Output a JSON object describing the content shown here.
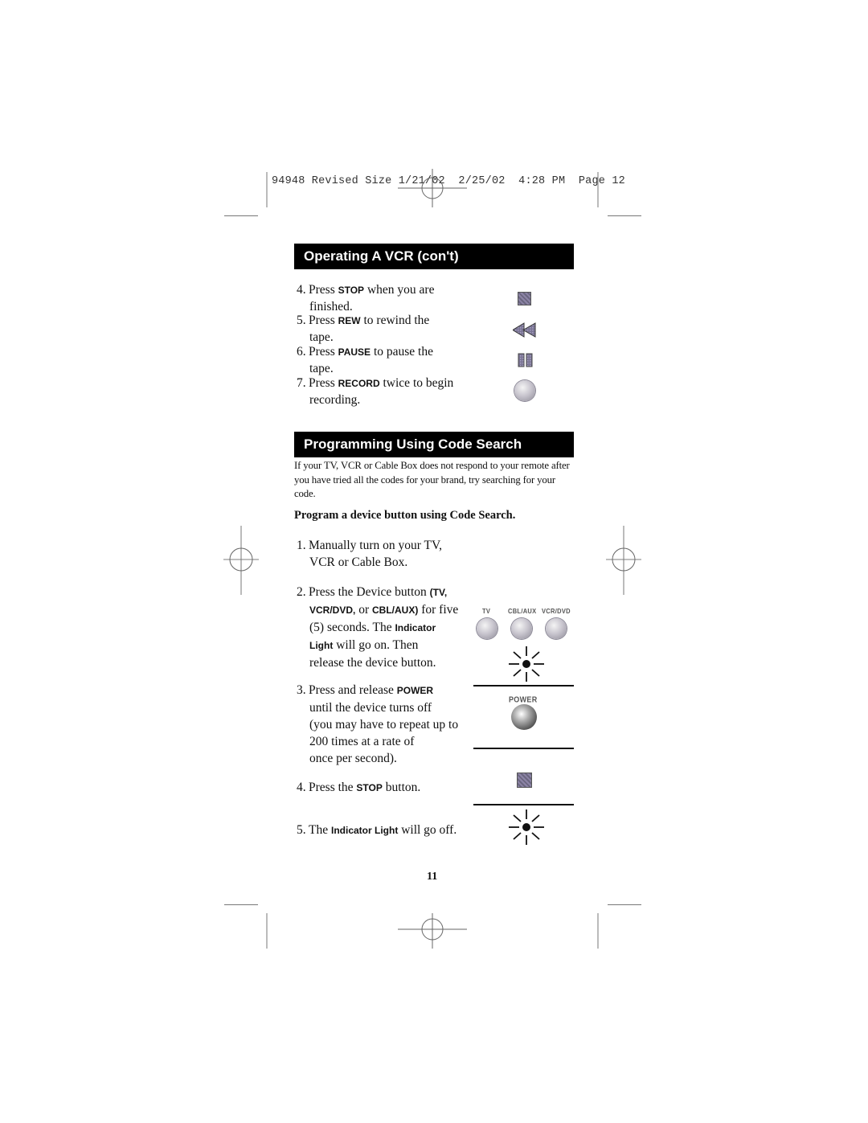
{
  "slug": {
    "text": "94948 Revised Size 1/21/02  2/25/02  4:28 PM  Page 12"
  },
  "section1": {
    "title": "Operating A VCR (con't)",
    "steps": [
      {
        "num": "4.",
        "pre": "Press ",
        "kw": "STOP",
        "post": " when you are",
        "cont": "finished.",
        "icon": "stop-icon"
      },
      {
        "num": "5.",
        "pre": "Press ",
        "kw": "REW",
        "post": " to rewind the",
        "cont": "tape.",
        "icon": "rewind-icon"
      },
      {
        "num": "6.",
        "pre": "Press ",
        "kw": "PAUSE",
        "post": " to pause the",
        "cont": "tape.",
        "icon": "pause-icon"
      },
      {
        "num": "7.",
        "pre": "Press ",
        "kw": "RECORD",
        "post": " twice to begin",
        "cont": "recording.",
        "icon": "record-icon"
      }
    ]
  },
  "section2": {
    "title": "Programming Using Code Search",
    "intro": "If your TV, VCR or Cable Box does not respond to your remote after you have tried all the codes for your brand, try searching for your code.",
    "subhead": "Program a device button using Code Search.",
    "step1": {
      "num": "1.",
      "line1": "Manually turn on your TV,",
      "line2": "VCR or Cable Box."
    },
    "step2": {
      "num": "2.",
      "l1_pre": "Press the Device button ",
      "l1_kw": "(TV,",
      "l2_kw1": "VCR/DVD,",
      "l2_mid": " or ",
      "l2_kw2": "CBL/AUX)",
      "l2_post": " for five",
      "l3_pre": "(5) seconds. The ",
      "l3_kw": "Indicator",
      "l4_kw": "Light",
      "l4_post": " will go on. Then",
      "l5": "release the device button."
    },
    "step3": {
      "num": "3.",
      "l1_pre": "Press and release ",
      "l1_kw": "POWER",
      "l2": "until the device turns off",
      "l3": "(you may have to repeat up to",
      "l4": "200 times at a rate of",
      "l5": "once per second)."
    },
    "step4": {
      "num": "4.",
      "pre": "Press the ",
      "kw": "STOP",
      "post": " button."
    },
    "step5": {
      "num": "5.",
      "pre": "The ",
      "kw": "Indicator Light",
      "post": " will go off."
    },
    "device_buttons": [
      "TV",
      "CBL/AUX",
      "VCR/DVD"
    ],
    "power_label": "POWER"
  },
  "page_number": "11"
}
